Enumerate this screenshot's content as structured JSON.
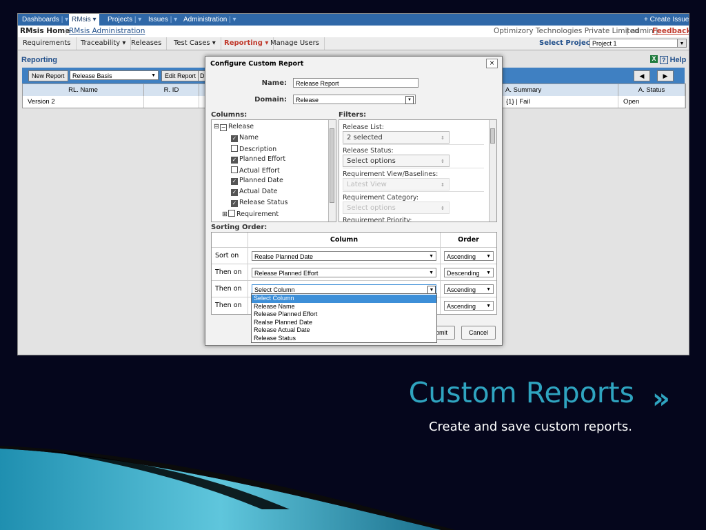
{
  "slide": {
    "title": "Custom Reports",
    "chevrons": "»",
    "subtitle": "Create and save custom reports.",
    "colors": {
      "background": "#05061c",
      "accent": "#2fa4c0"
    }
  },
  "topnav": {
    "items": [
      "Dashboards",
      "RMsis",
      "Projects",
      "Issues",
      "Administration"
    ],
    "create_issue": "+ Create Issue"
  },
  "subheader": {
    "home": "RMsis Home",
    "admin_link": "RMsis Administration",
    "company": "Optimizory Technologies Private Limited",
    "user": "admin",
    "feedback": "Feedback"
  },
  "menubar": {
    "items": [
      "Requirements",
      "Traceability ▾",
      "Releases",
      "Test Cases ▾",
      "Reporting ▾",
      "Manage Users"
    ],
    "select_project_label": "Select Project:",
    "project_value": "Project 1"
  },
  "reporting": {
    "title": "Reporting",
    "help": "Help",
    "new_report": "New Report",
    "report_type": "Release Basis",
    "edit_report": "Edit Report",
    "extra_button": "D",
    "columns": [
      "RL. Name",
      "R. ID",
      "",
      "A. Summary",
      "A. Status"
    ],
    "row": [
      "Version 2",
      "",
      "",
      "{1} | Fail",
      "Open"
    ]
  },
  "dialog": {
    "title": "Configure Custom Report",
    "close": "×",
    "name_label": "Name:",
    "name_value": "Release Report",
    "domain_label": "Domain:",
    "domain_value": "Release",
    "columns_label": "Columns:",
    "filters_label": "Filters:",
    "tree_root": "Release",
    "tree_items": [
      {
        "label": "Name",
        "checked": true
      },
      {
        "label": "Description",
        "checked": false
      },
      {
        "label": "Planned Effort",
        "checked": true
      },
      {
        "label": "Actual Effort",
        "checked": false
      },
      {
        "label": "Planned Date",
        "checked": true
      },
      {
        "label": "Actual Date",
        "checked": true
      },
      {
        "label": "Release Status",
        "checked": true
      }
    ],
    "tree_child": "Requirement",
    "filters": [
      {
        "label": "Release List:",
        "value": "2 selected"
      },
      {
        "label": "Release Status:",
        "value": "Select options"
      },
      {
        "label": "Requirement View/Baselines:",
        "value": "Latest View"
      },
      {
        "label": "Requirement Category:",
        "value": "Select options"
      },
      {
        "label": "Requirement Priority:",
        "value": ""
      }
    ],
    "sorting_label": "Sorting Order:",
    "sort_head": {
      "column": "Column",
      "order": "Order"
    },
    "sort_rows": [
      {
        "label": "Sort on",
        "column": "Realse Planned Date",
        "order": "Ascending"
      },
      {
        "label": "Then on",
        "column": "Release Planned Effort",
        "order": "Descending"
      },
      {
        "label": "Then on",
        "column": "Select Column",
        "order": "Ascending"
      },
      {
        "label": "Then on",
        "column": "",
        "order": "Ascending"
      }
    ],
    "dropdown_options": [
      "Select Column",
      "Release Name",
      "Release Planned Effort",
      "Realse Planned Date",
      "Release Actual Date",
      "Release Status"
    ],
    "submit": "ubmit",
    "cancel": "Cancel"
  }
}
